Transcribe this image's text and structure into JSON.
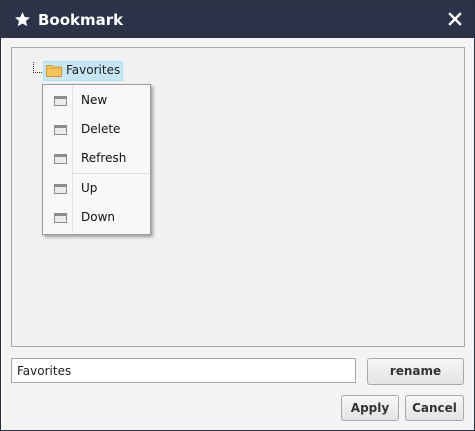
{
  "window": {
    "title": "Bookmark",
    "title_icon": "star-icon",
    "close_icon": "close-icon"
  },
  "tree": {
    "root": {
      "label": "Favorites",
      "icon": "folder-icon",
      "selected": true
    }
  },
  "context_menu": {
    "items": [
      {
        "label": "New",
        "icon": "menu-item-icon"
      },
      {
        "label": "Delete",
        "icon": "menu-item-icon"
      },
      {
        "label": "Refresh",
        "icon": "menu-item-icon"
      },
      {
        "label": "Up",
        "icon": "menu-item-icon"
      },
      {
        "label": "Down",
        "icon": "menu-item-icon"
      }
    ]
  },
  "footer": {
    "name_value": "Favorites",
    "rename_label": "rename",
    "apply_label": "Apply",
    "cancel_label": "Cancel"
  },
  "colors": {
    "titlebar": "#2c3348",
    "selection": "#c6e6f6",
    "folder": "#f5c35a"
  }
}
